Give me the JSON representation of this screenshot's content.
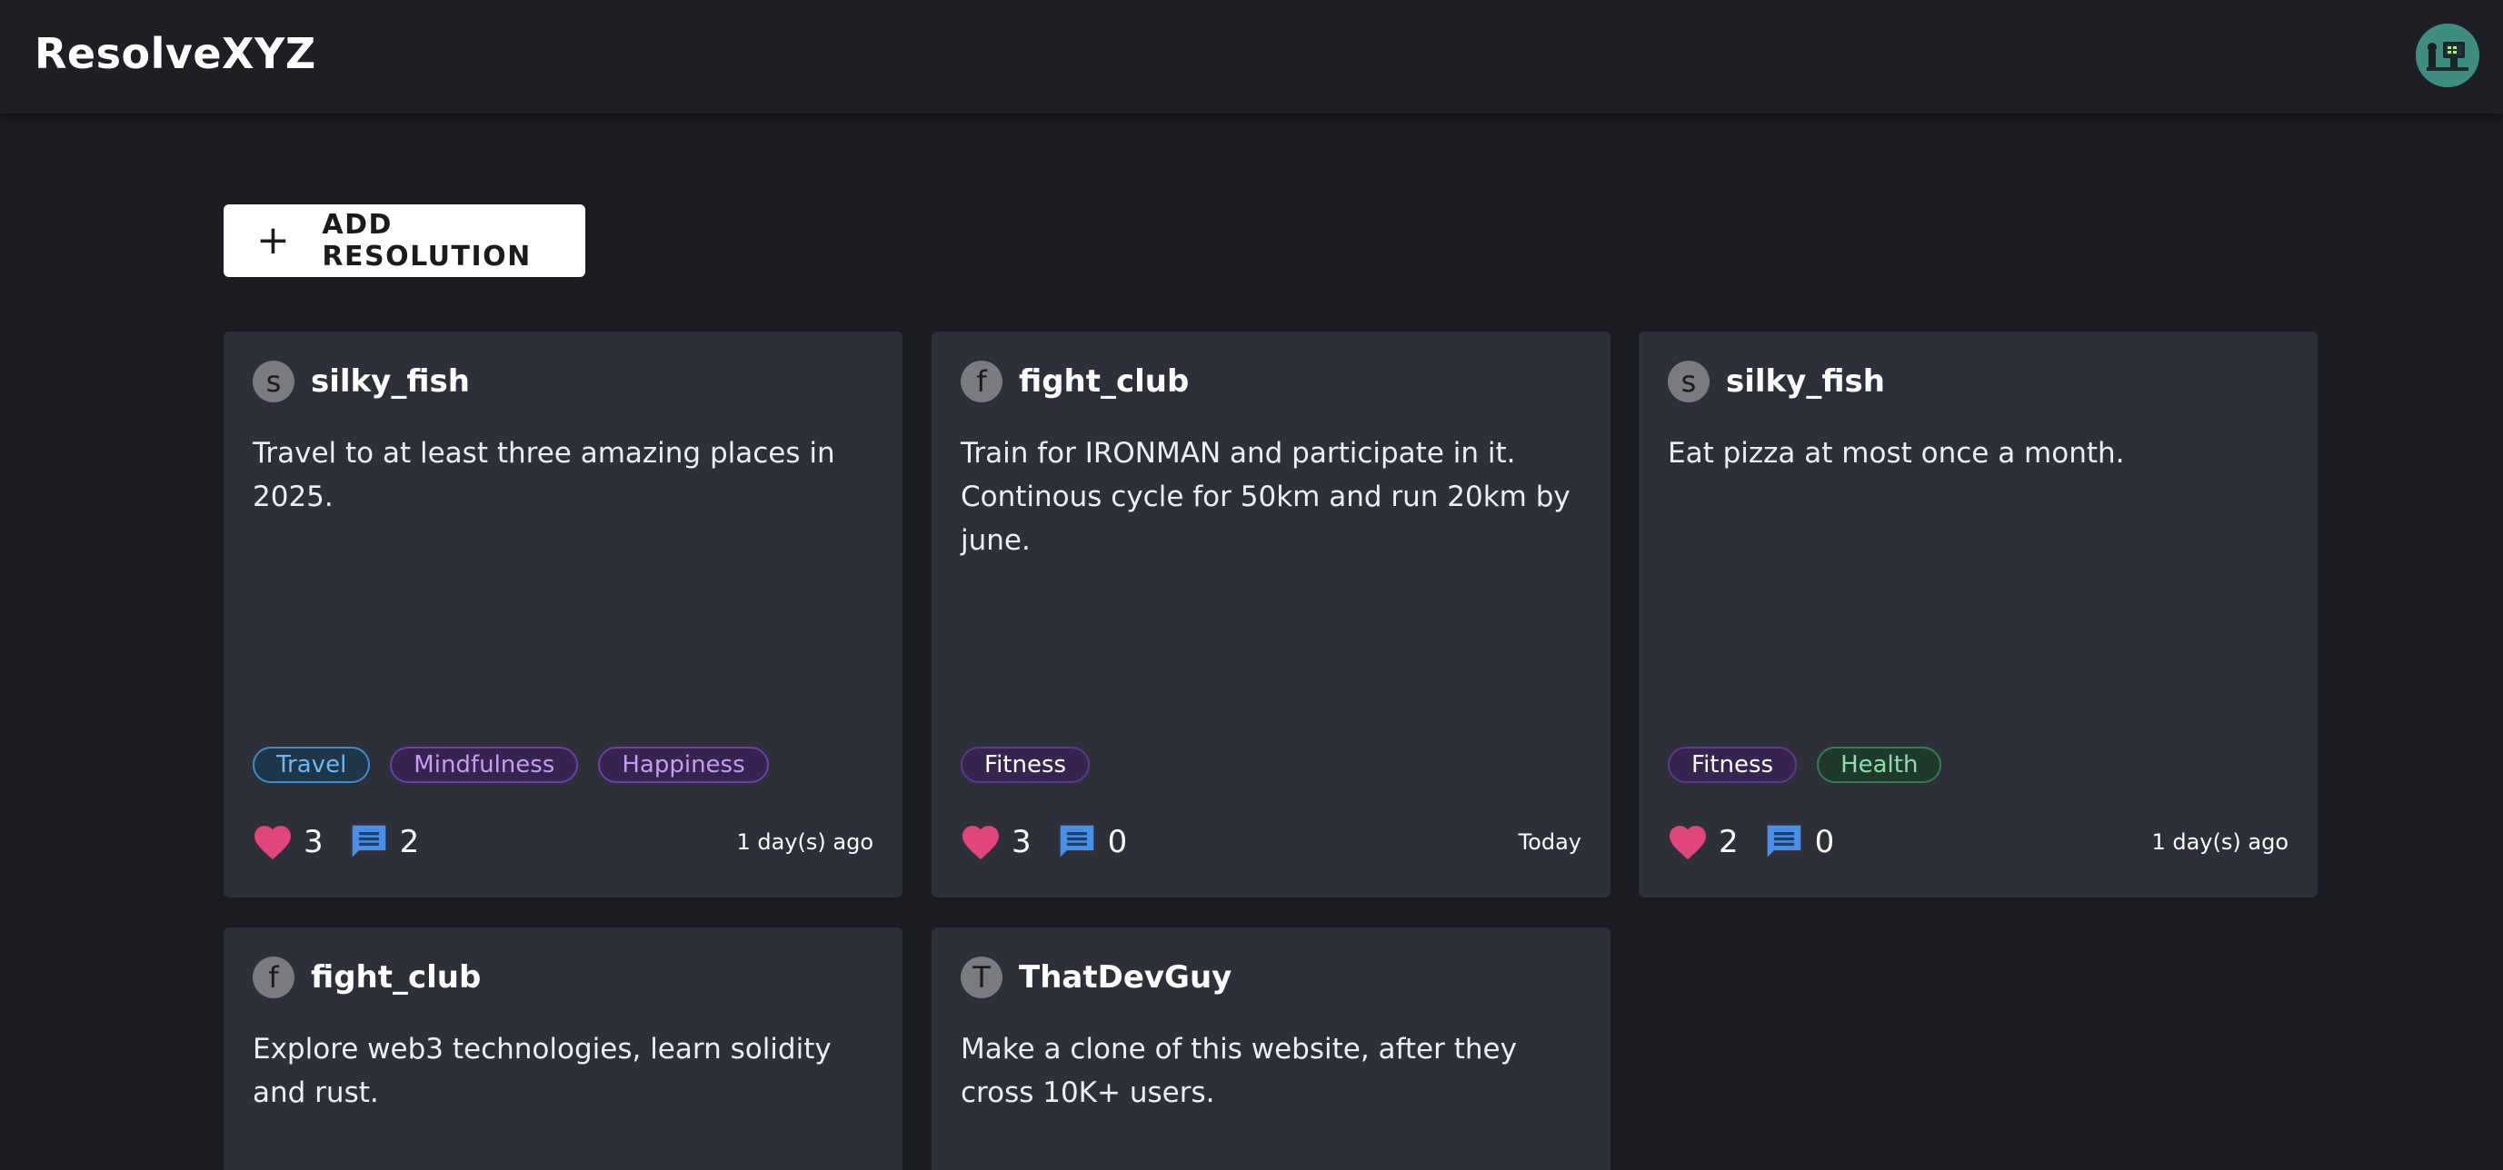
{
  "app": {
    "brand": "ResolveXYZ"
  },
  "toolbar": {
    "add_label": "ADD RESOLUTION",
    "add_icon": "plus-icon"
  },
  "colors": {
    "background": "#1a1c21",
    "card": "#2e3039",
    "like": "#e0457b",
    "comment": "#4a8fe7"
  },
  "cards": [
    {
      "initial": "s",
      "username": "silky_fish",
      "text": "Travel to at least three amazing places in 2025.",
      "tags": [
        "Travel",
        "Mindfulness",
        "Happiness"
      ],
      "likes": "3",
      "comments": "2",
      "time": "1 day(s) ago"
    },
    {
      "initial": "f",
      "username": "fight_club",
      "text": "Train for IRONMAN and participate in it. Continous cycle for 50km and run 20km by june.",
      "tags": [
        "Fitness"
      ],
      "likes": "3",
      "comments": "0",
      "time": "Today"
    },
    {
      "initial": "s",
      "username": "silky_fish",
      "text": "Eat pizza at most once a month.",
      "tags": [
        "Fitness",
        "Health"
      ],
      "likes": "2",
      "comments": "0",
      "time": "1 day(s) ago"
    },
    {
      "initial": "f",
      "username": "fight_club",
      "text": "Explore web3 technologies, learn solidity and rust."
    },
    {
      "initial": "T",
      "username": "ThatDevGuy",
      "text": "Make a clone of this website, after they cross 10K+ users."
    }
  ]
}
